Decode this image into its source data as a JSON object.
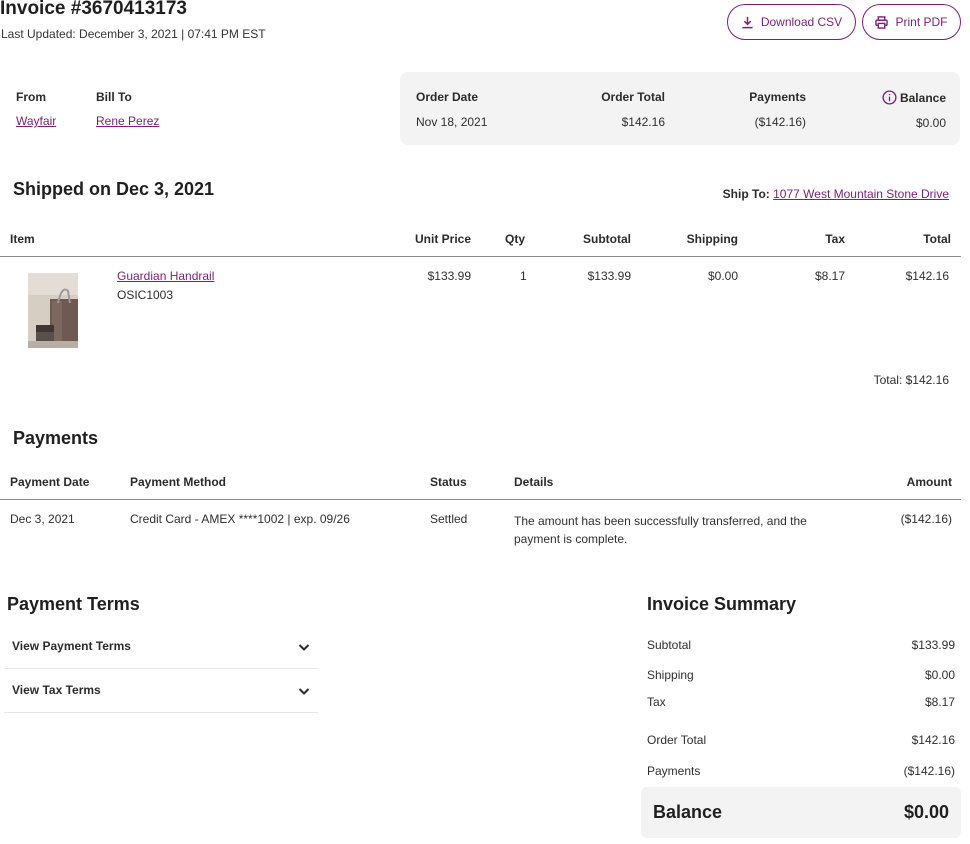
{
  "header": {
    "title": "Invoice #3670413173",
    "last_updated": "Last Updated: December 3, 2021 | 07:41 PM EST",
    "download_csv_label": "Download CSV",
    "download_icon": "download-icon",
    "print_pdf_label": "Print PDF",
    "print_icon": "printer-icon"
  },
  "parties": {
    "from_label": "From",
    "from_value": "Wayfair",
    "bill_to_label": "Bill To",
    "bill_to_value": "Rene Perez"
  },
  "order_summary": {
    "order_date_label": "Order Date",
    "order_date": "Nov 18, 2021",
    "order_total_label": "Order Total",
    "order_total": "$142.16",
    "payments_label": "Payments",
    "payments": "($142.16)",
    "balance_label": "Balance",
    "balance_icon": "info-icon",
    "balance": "$0.00"
  },
  "shipment": {
    "title": "Shipped on Dec 3, 2021",
    "ship_to_label": "Ship To:",
    "ship_to_address": "1077 West Mountain Stone Drive",
    "columns": {
      "item": "Item",
      "unit_price": "Unit Price",
      "qty": "Qty",
      "subtotal": "Subtotal",
      "shipping": "Shipping",
      "tax": "Tax",
      "total": "Total"
    },
    "items": [
      {
        "name": "Guardian Handrail",
        "sku": "OSIC1003",
        "unit_price": "$133.99",
        "qty": "1",
        "subtotal": "$133.99",
        "shipping": "$0.00",
        "tax": "$8.17",
        "total": "$142.16"
      }
    ],
    "total_line": "Total: $142.16"
  },
  "payments": {
    "title": "Payments",
    "columns": {
      "date": "Payment Date",
      "method": "Payment Method",
      "status": "Status",
      "details": "Details",
      "amount": "Amount"
    },
    "rows": [
      {
        "date": "Dec 3, 2021",
        "method": "Credit Card - AMEX ****1002 | exp. 09/26",
        "status": "Settled",
        "details_line1": "The amount has been successfully transferred, and the",
        "details_line2": "payment is complete.",
        "amount": "($142.16)"
      }
    ]
  },
  "payment_terms": {
    "title": "Payment Terms",
    "items": [
      {
        "label": "View Payment Terms",
        "icon": "chevron-down-icon"
      },
      {
        "label": "View Tax Terms",
        "icon": "chevron-down-icon"
      }
    ]
  },
  "invoice_summary": {
    "title": "Invoice Summary",
    "subtotal_label": "Subtotal",
    "subtotal": "$133.99",
    "shipping_label": "Shipping",
    "shipping": "$0.00",
    "tax_label": "Tax",
    "tax": "$8.17",
    "order_total_label": "Order Total",
    "order_total": "$142.16",
    "payments_label": "Payments",
    "payments": "($142.16)",
    "balance_label": "Balance",
    "balance": "$0.00"
  },
  "colors": {
    "accent": "#7b1e7a",
    "panel_bg": "#f3f3f3",
    "text": "#2f2f2f"
  }
}
